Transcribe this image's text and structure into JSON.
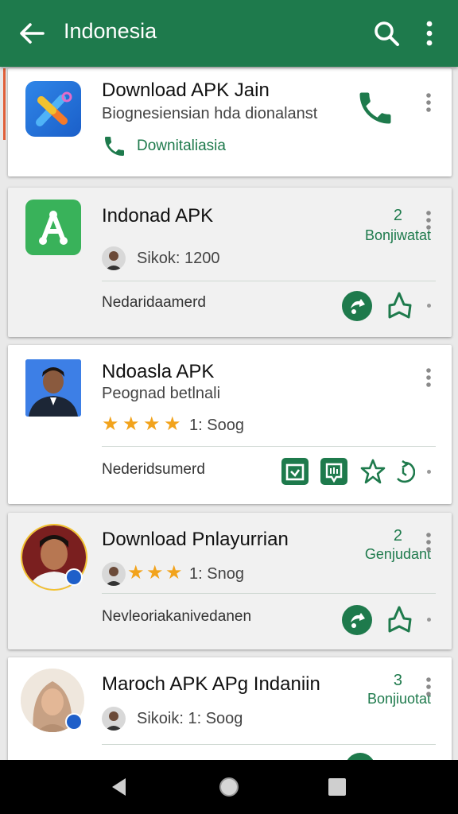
{
  "appbar": {
    "title": "Indonesia"
  },
  "cards": [
    {
      "title": "Download APK Jain",
      "subtitle": "Biognesiensian hda dionalanst",
      "link": "Downitaliasia"
    },
    {
      "title": "Indonad APK",
      "count": "2",
      "count_label": "Bonjiwatat",
      "meta": "Sikok: 1200",
      "footer": "Nedaridaamerd"
    },
    {
      "title": "Ndoasla APK",
      "subtitle": "Peognad betlnali",
      "rating_text": "1: Soog",
      "footer": "Nederidsumerd"
    },
    {
      "title": "Download Pnlayurrian",
      "count": "2",
      "count_label": "Genjudant",
      "rating_text": "1: Snog",
      "footer": "Nevleoriakanivedanen"
    },
    {
      "title": "Maroch APK  APg Indaniin",
      "count": "3",
      "count_label": "Bonjiuotat",
      "meta": "Sikoik: 1: Soog"
    }
  ],
  "colors": {
    "primary": "#1e7a4c",
    "star": "#f2a31c",
    "accent": "#e0603a"
  }
}
